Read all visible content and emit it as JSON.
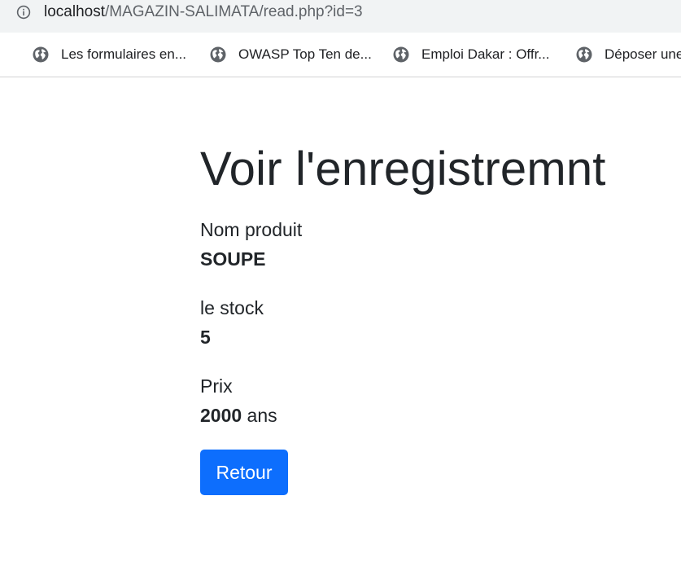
{
  "browser": {
    "url_host": "localhost",
    "url_path": "/MAGAZIN-SALIMATA/read.php?id=3",
    "bookmarks": [
      {
        "label": "...",
        "icon": "globe-icon"
      },
      {
        "label": "Les formulaires en...",
        "icon": "globe-icon"
      },
      {
        "label": "OWASP Top Ten de...",
        "icon": "globe-icon"
      },
      {
        "label": "Emploi Dakar : Offr...",
        "icon": "globe-icon"
      },
      {
        "label": "Déposer une",
        "icon": "globe-icon"
      }
    ]
  },
  "page": {
    "title": "Voir l'enregistremnt",
    "fields": [
      {
        "label": "Nom produit",
        "value": "SOUPE",
        "suffix": ""
      },
      {
        "label": "le stock",
        "value": "5",
        "suffix": ""
      },
      {
        "label": "Prix",
        "value": "2000",
        "suffix": " ans"
      }
    ],
    "back_button": "Retour"
  },
  "colors": {
    "primary": "#0d6efd",
    "text": "#212529"
  }
}
